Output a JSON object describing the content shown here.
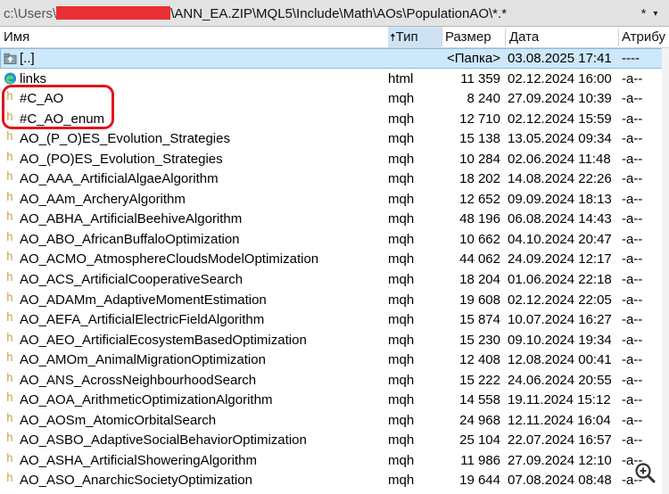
{
  "pathbar": {
    "prefix": "c:\\Users\\",
    "path": "\\ANN_EA.ZIP\\MQL5\\Include\\Math\\AOs\\PopulationAO\\*.*",
    "filter_label": "*",
    "chevron": "▾"
  },
  "columns": {
    "name": "Имя",
    "type_arrow": "🠅",
    "type": "Тип",
    "size": "Размер",
    "date": "Дата",
    "attr": "Атрибу"
  },
  "parent_row": {
    "name": "[..]",
    "type": "",
    "size": "<Папка>",
    "date": "03.08.2025 17:41",
    "attr": "----"
  },
  "rows": [
    {
      "name": "links",
      "type": "html",
      "size": "11 359",
      "date": "02.12.2024 16:00",
      "attr": "-a--",
      "icon": "edge-html-icon"
    },
    {
      "name": "#C_AO",
      "type": "mqh",
      "size": "8 240",
      "date": "27.09.2024 10:39",
      "attr": "-a--",
      "icon": "header-file-icon"
    },
    {
      "name": "#C_AO_enum",
      "type": "mqh",
      "size": "12 710",
      "date": "02.12.2024 15:59",
      "attr": "-a--",
      "icon": "header-file-icon"
    },
    {
      "name": "AO_(P_O)ES_Evolution_Strategies",
      "type": "mqh",
      "size": "15 138",
      "date": "13.05.2024 09:34",
      "attr": "-a--",
      "icon": "header-file-icon"
    },
    {
      "name": "AO_(PO)ES_Evolution_Strategies",
      "type": "mqh",
      "size": "10 284",
      "date": "02.06.2024 11:48",
      "attr": "-a--",
      "icon": "header-file-icon"
    },
    {
      "name": "AO_AAA_ArtificialAlgaeAlgorithm",
      "type": "mqh",
      "size": "18 202",
      "date": "14.08.2024 22:26",
      "attr": "-a--",
      "icon": "header-file-icon"
    },
    {
      "name": "AO_AAm_ArcheryAlgorithm",
      "type": "mqh",
      "size": "12 652",
      "date": "09.09.2024 18:13",
      "attr": "-a--",
      "icon": "header-file-icon"
    },
    {
      "name": "AO_ABHA_ArtificialBeehiveAlgorithm",
      "type": "mqh",
      "size": "48 196",
      "date": "06.08.2024 14:43",
      "attr": "-a--",
      "icon": "header-file-icon"
    },
    {
      "name": "AO_ABO_AfricanBuffaloOptimization",
      "type": "mqh",
      "size": "10 662",
      "date": "04.10.2024 20:47",
      "attr": "-a--",
      "icon": "header-file-icon"
    },
    {
      "name": "AO_ACMO_AtmosphereCloudsModelOptimization",
      "type": "mqh",
      "size": "44 062",
      "date": "24.09.2024 12:17",
      "attr": "-a--",
      "icon": "header-file-icon"
    },
    {
      "name": "AO_ACS_ArtificialCooperativeSearch",
      "type": "mqh",
      "size": "18 204",
      "date": "01.06.2024 22:18",
      "attr": "-a--",
      "icon": "header-file-icon"
    },
    {
      "name": "AO_ADAMm_AdaptiveMomentEstimation",
      "type": "mqh",
      "size": "19 608",
      "date": "02.12.2024 22:05",
      "attr": "-a--",
      "icon": "header-file-icon"
    },
    {
      "name": "AO_AEFA_ArtificialElectricFieldAlgorithm",
      "type": "mqh",
      "size": "15 874",
      "date": "10.07.2024 16:27",
      "attr": "-a--",
      "icon": "header-file-icon"
    },
    {
      "name": "AO_AEO_ArtificialEcosystemBasedOptimization",
      "type": "mqh",
      "size": "15 230",
      "date": "09.10.2024 19:34",
      "attr": "-a--",
      "icon": "header-file-icon"
    },
    {
      "name": "AO_AMOm_AnimalMigrationOptimization",
      "type": "mqh",
      "size": "12 408",
      "date": "12.08.2024 00:41",
      "attr": "-a--",
      "icon": "header-file-icon"
    },
    {
      "name": "AO_ANS_AcrossNeighbourhoodSearch",
      "type": "mqh",
      "size": "15 222",
      "date": "24.06.2024 20:55",
      "attr": "-a--",
      "icon": "header-file-icon"
    },
    {
      "name": "AO_AOA_ArithmeticOptimizationAlgorithm",
      "type": "mqh",
      "size": "14 558",
      "date": "19.11.2024 15:12",
      "attr": "-a--",
      "icon": "header-file-icon"
    },
    {
      "name": "AO_AOSm_AtomicOrbitalSearch",
      "type": "mqh",
      "size": "24 968",
      "date": "12.11.2024 16:04",
      "attr": "-a--",
      "icon": "header-file-icon"
    },
    {
      "name": "AO_ASBO_AdaptiveSocialBehaviorOptimization",
      "type": "mqh",
      "size": "25 104",
      "date": "22.07.2024 16:57",
      "attr": "-a--",
      "icon": "header-file-icon"
    },
    {
      "name": "AO_ASHA_ArtificialShoweringAlgorithm",
      "type": "mqh",
      "size": "11 986",
      "date": "27.09.2024 12:10",
      "attr": "-a--",
      "icon": "header-file-icon"
    },
    {
      "name": "AO_ASO_AnarchicSocietyOptimization",
      "type": "mqh",
      "size": "19 644",
      "date": "07.08.2024 08:48",
      "attr": "-a--",
      "icon": "header-file-icon"
    }
  ],
  "colors": {
    "selected_row": "#cde8fb",
    "sorted_column": "#cde3f5",
    "highlight_ring": "#e3141b",
    "redaction": "#ea2f32",
    "header_file_icon": "#c9a64a"
  },
  "icons": {
    "parent": "up-folder-icon",
    "html": "edge-html-icon",
    "mqh": "header-file-icon",
    "zoom": "zoom-in-icon",
    "filter": "asterisk-filter-icon"
  }
}
